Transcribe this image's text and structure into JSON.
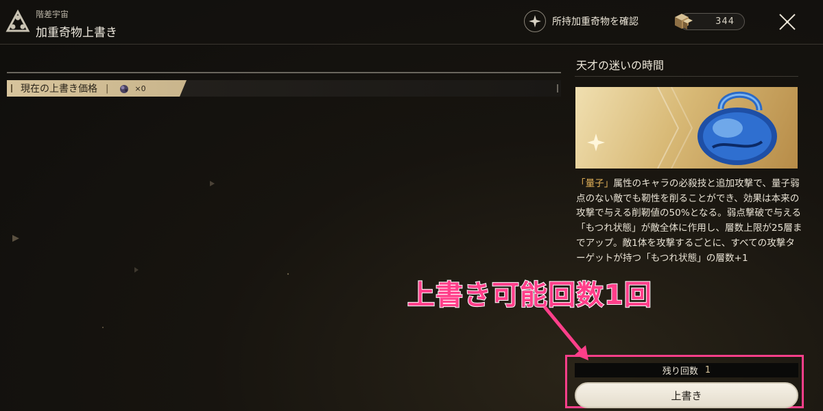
{
  "header": {
    "breadcrumb": "階差宇宙",
    "title": "加重奇物上書き",
    "check_button": "所持加重奇物を確認",
    "currency_value": "344"
  },
  "price_bar": {
    "label": "現在の上書き価格",
    "separator": "|",
    "count": "×0"
  },
  "panel": {
    "title": "天才の迷いの時間",
    "desc_highlight": "「量子」",
    "description": "属性のキャラの必殺技と追加攻撃で、量子弱点のない敵でも靭性を削ることができ、効果は本来の攻撃で与える削靭値の50%となる。弱点撃破で与える「もつれ状態」が敵全体に作用し、層数上限が25層までアップ。敵1体を攻撃するごとに、すべての攻撃ターゲットが持つ「もつれ状態」の層数+1"
  },
  "footer": {
    "remaining_label": "残り回数",
    "remaining_count": "1",
    "overwrite_button": "上書き"
  },
  "annotation": {
    "text": "上書き可能回数1回",
    "color": "#ff3f8a"
  },
  "icons": {
    "logo": "triangle-emblem-icon",
    "check": "sparkle-icon",
    "currency": "cube-currency-icon",
    "close": "close-icon",
    "price": "curio-icon",
    "banner": "blue-lock-icon"
  }
}
